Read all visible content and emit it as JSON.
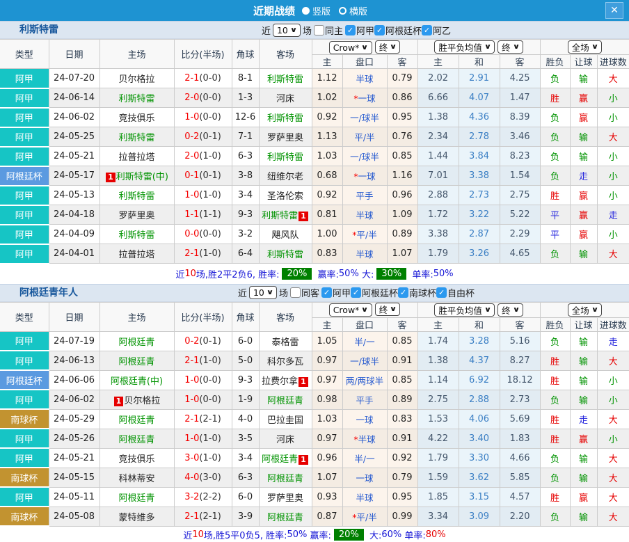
{
  "titlebar": {
    "title": "近期战绩",
    "portrait_label": "竖版",
    "landscape_label": "横版",
    "close_label": "✕"
  },
  "labels": {
    "near": "近",
    "games": "场"
  },
  "dropdowns": {
    "count": "10",
    "company": "Crow*",
    "final": "终",
    "avg": "胜平负均值",
    "scope": "全场"
  },
  "columns": {
    "type": "类型",
    "date": "日期",
    "home": "主场",
    "score": "比分(半场)",
    "corner": "角球",
    "away": "客场",
    "sub": [
      "主",
      "盘口",
      "客",
      "主",
      "和",
      "客",
      "胜负",
      "让球",
      "进球数"
    ]
  },
  "colors": {
    "titlebar": "#1e93d2",
    "league_jia": "#16c5c5",
    "league_acup": "#5b9ae0",
    "league_scup": "#c29330",
    "win_red": "#e60000",
    "lose_green": "#009300",
    "draw_blue": "#2525dd",
    "summary_green_box": "#008000"
  },
  "sections": [
    {
      "team": "利斯特雷",
      "same": {
        "label": "同主",
        "checked": false
      },
      "leagues": [
        {
          "label": "阿甲",
          "checked": true
        },
        {
          "label": "阿根廷杯",
          "checked": true
        },
        {
          "label": "阿乙",
          "checked": true
        }
      ],
      "rows": [
        {
          "type": "阿甲",
          "tc": "jia",
          "date": "24-07-20",
          "home": {
            "n": "贝尔格拉",
            "g": false
          },
          "ft": "2-1",
          "ht": "(0-0)",
          "cn": "8-1",
          "away": {
            "n": "利斯特雷",
            "g": true
          },
          "h": "1.12",
          "star": false,
          "hc": "半球",
          "a": "0.79",
          "m1": "2.02",
          "m2": "2.91",
          "m3": "4.25",
          "r": [
            [
              "负",
              "g"
            ],
            [
              "输",
              "g"
            ],
            [
              "大",
              "r"
            ]
          ]
        },
        {
          "type": "阿甲",
          "tc": "jia",
          "date": "24-06-14",
          "home": {
            "n": "利斯特雷",
            "g": true
          },
          "ft": "2-0",
          "ht": "(0-0)",
          "cn": "1-3",
          "away": {
            "n": "河床",
            "g": false
          },
          "h": "1.02",
          "star": true,
          "hc": "一球",
          "a": "0.86",
          "m1": "6.66",
          "m2": "4.07",
          "m3": "1.47",
          "r": [
            [
              "胜",
              "r"
            ],
            [
              "赢",
              "r"
            ],
            [
              "小",
              "g"
            ]
          ]
        },
        {
          "type": "阿甲",
          "tc": "jia",
          "date": "24-06-02",
          "home": {
            "n": "竞技俱乐",
            "g": false
          },
          "ft": "1-0",
          "ht": "(0-0)",
          "cn": "12-6",
          "away": {
            "n": "利斯特雷",
            "g": true
          },
          "h": "0.92",
          "star": false,
          "hc": "一/球半",
          "a": "0.95",
          "m1": "1.38",
          "m2": "4.36",
          "m3": "8.39",
          "r": [
            [
              "负",
              "g"
            ],
            [
              "赢",
              "r"
            ],
            [
              "小",
              "g"
            ]
          ]
        },
        {
          "type": "阿甲",
          "tc": "jia",
          "date": "24-05-25",
          "home": {
            "n": "利斯特雷",
            "g": true
          },
          "ft": "0-2",
          "ht": "(0-1)",
          "cn": "7-1",
          "away": {
            "n": "罗萨里奥",
            "g": false
          },
          "h": "1.13",
          "star": false,
          "hc": "平/半",
          "a": "0.76",
          "m1": "2.34",
          "m2": "2.78",
          "m3": "3.46",
          "r": [
            [
              "负",
              "g"
            ],
            [
              "输",
              "g"
            ],
            [
              "大",
              "r"
            ]
          ]
        },
        {
          "type": "阿甲",
          "tc": "jia",
          "date": "24-05-21",
          "home": {
            "n": "拉普拉塔",
            "g": false
          },
          "ft": "2-0",
          "ht": "(1-0)",
          "cn": "6-3",
          "away": {
            "n": "利斯特雷",
            "g": true
          },
          "h": "1.03",
          "star": false,
          "hc": "一/球半",
          "a": "0.85",
          "m1": "1.44",
          "m2": "3.84",
          "m3": "8.23",
          "r": [
            [
              "负",
              "g"
            ],
            [
              "输",
              "g"
            ],
            [
              "小",
              "g"
            ]
          ]
        },
        {
          "type": "阿根廷杯",
          "tc": "acup",
          "date": "24-05-17",
          "home": {
            "n": "利斯特雷(中)",
            "g": true,
            "b": "pre"
          },
          "ft": "0-1",
          "ht": "(0-1)",
          "cn": "3-8",
          "away": {
            "n": "纽维尔老",
            "g": false
          },
          "h": "0.68",
          "star": true,
          "hc": "一球",
          "a": "1.16",
          "m1": "7.01",
          "m2": "3.38",
          "m3": "1.54",
          "r": [
            [
              "负",
              "g"
            ],
            [
              "走",
              "b"
            ],
            [
              "小",
              "g"
            ]
          ]
        },
        {
          "type": "阿甲",
          "tc": "jia",
          "date": "24-05-13",
          "home": {
            "n": "利斯特雷",
            "g": true
          },
          "ft": "1-0",
          "ht": "(1-0)",
          "cn": "3-4",
          "away": {
            "n": "圣洛伦索",
            "g": false
          },
          "h": "0.92",
          "star": false,
          "hc": "平手",
          "a": "0.96",
          "m1": "2.88",
          "m2": "2.73",
          "m3": "2.75",
          "r": [
            [
              "胜",
              "r"
            ],
            [
              "赢",
              "r"
            ],
            [
              "小",
              "g"
            ]
          ]
        },
        {
          "type": "阿甲",
          "tc": "jia",
          "date": "24-04-18",
          "home": {
            "n": "罗萨里奥",
            "g": false
          },
          "ft": "1-1",
          "ht": "(1-1)",
          "cn": "9-3",
          "away": {
            "n": "利斯特雷",
            "g": true,
            "b": "post"
          },
          "h": "0.81",
          "star": false,
          "hc": "半球",
          "a": "1.09",
          "m1": "1.72",
          "m2": "3.22",
          "m3": "5.22",
          "r": [
            [
              "平",
              "b"
            ],
            [
              "赢",
              "r"
            ],
            [
              "走",
              "b"
            ]
          ]
        },
        {
          "type": "阿甲",
          "tc": "jia",
          "date": "24-04-09",
          "home": {
            "n": "利斯特雷",
            "g": true
          },
          "ft": "0-0",
          "ht": "(0-0)",
          "cn": "3-2",
          "away": {
            "n": "飓风队",
            "g": false
          },
          "h": "1.00",
          "star": true,
          "hc": "平/半",
          "a": "0.89",
          "m1": "3.38",
          "m2": "2.87",
          "m3": "2.29",
          "r": [
            [
              "平",
              "b"
            ],
            [
              "赢",
              "r"
            ],
            [
              "小",
              "g"
            ]
          ]
        },
        {
          "type": "阿甲",
          "tc": "jia",
          "date": "24-04-01",
          "home": {
            "n": "拉普拉塔",
            "g": false
          },
          "ft": "2-1",
          "ht": "(1-0)",
          "cn": "6-4",
          "away": {
            "n": "利斯特雷",
            "g": true
          },
          "h": "0.83",
          "star": false,
          "hc": "半球",
          "a": "1.07",
          "m1": "1.79",
          "m2": "3.26",
          "m3": "4.65",
          "r": [
            [
              "负",
              "g"
            ],
            [
              "输",
              "g"
            ],
            [
              "大",
              "r"
            ]
          ]
        }
      ],
      "summary": [
        {
          "t": "近",
          "c": "b"
        },
        {
          "t": "10",
          "c": "r"
        },
        {
          "t": "场,胜2平2负6, 胜率:",
          "c": "b"
        },
        {
          "t": "20%",
          "c": "gb"
        },
        {
          "t": " 赢率:",
          "c": "b"
        },
        {
          "t": "50%",
          "c": "b"
        },
        {
          "t": " 大:",
          "c": "b"
        },
        {
          "t": "30%",
          "c": "gb"
        },
        {
          "t": " 单率:",
          "c": "b"
        },
        {
          "t": "50%",
          "c": "b"
        }
      ]
    },
    {
      "team": "阿根廷青年人",
      "same": {
        "label": "同客",
        "checked": false
      },
      "leagues": [
        {
          "label": "阿甲",
          "checked": true
        },
        {
          "label": "阿根廷杯",
          "checked": true
        },
        {
          "label": "南球杯",
          "checked": true
        },
        {
          "label": "自由杯",
          "checked": true
        }
      ],
      "rows": [
        {
          "type": "阿甲",
          "tc": "jia",
          "date": "24-07-19",
          "home": {
            "n": "阿根廷青",
            "g": true
          },
          "ft": "0-2",
          "ht": "(0-1)",
          "cn": "6-0",
          "away": {
            "n": "泰格雷",
            "g": false
          },
          "h": "1.05",
          "star": false,
          "hc": "半/一",
          "a": "0.85",
          "m1": "1.74",
          "m2": "3.28",
          "m3": "5.16",
          "r": [
            [
              "负",
              "g"
            ],
            [
              "输",
              "g"
            ],
            [
              "走",
              "b"
            ]
          ]
        },
        {
          "type": "阿甲",
          "tc": "jia",
          "date": "24-06-13",
          "home": {
            "n": "阿根廷青",
            "g": true
          },
          "ft": "2-1",
          "ht": "(1-0)",
          "cn": "5-0",
          "away": {
            "n": "科尔多瓦",
            "g": false
          },
          "h": "0.97",
          "star": false,
          "hc": "一/球半",
          "a": "0.91",
          "m1": "1.38",
          "m2": "4.37",
          "m3": "8.27",
          "r": [
            [
              "胜",
              "r"
            ],
            [
              "输",
              "g"
            ],
            [
              "大",
              "r"
            ]
          ]
        },
        {
          "type": "阿根廷杯",
          "tc": "acup",
          "date": "24-06-06",
          "home": {
            "n": "阿根廷青(中)",
            "g": true
          },
          "ft": "1-0",
          "ht": "(0-0)",
          "cn": "9-3",
          "away": {
            "n": "拉费尔拿",
            "g": false,
            "b": "post"
          },
          "h": "0.97",
          "star": false,
          "hc": "两/两球半",
          "a": "0.85",
          "m1": "1.14",
          "m2": "6.92",
          "m3": "18.12",
          "r": [
            [
              "胜",
              "r"
            ],
            [
              "输",
              "g"
            ],
            [
              "小",
              "g"
            ]
          ]
        },
        {
          "type": "阿甲",
          "tc": "jia",
          "date": "24-06-02",
          "home": {
            "n": "贝尔格拉",
            "g": false,
            "b": "pre"
          },
          "ft": "1-0",
          "ht": "(0-0)",
          "cn": "1-9",
          "away": {
            "n": "阿根廷青",
            "g": true
          },
          "h": "0.98",
          "star": false,
          "hc": "平手",
          "a": "0.89",
          "m1": "2.75",
          "m2": "2.88",
          "m3": "2.73",
          "r": [
            [
              "负",
              "g"
            ],
            [
              "输",
              "g"
            ],
            [
              "小",
              "g"
            ]
          ]
        },
        {
          "type": "南球杯",
          "tc": "scup",
          "date": "24-05-29",
          "home": {
            "n": "阿根廷青",
            "g": true
          },
          "ft": "2-1",
          "ht": "(2-1)",
          "cn": "4-0",
          "away": {
            "n": "巴拉圭国",
            "g": false
          },
          "h": "1.03",
          "star": false,
          "hc": "一球",
          "a": "0.83",
          "m1": "1.53",
          "m2": "4.06",
          "m3": "5.69",
          "r": [
            [
              "胜",
              "r"
            ],
            [
              "走",
              "b"
            ],
            [
              "大",
              "r"
            ]
          ]
        },
        {
          "type": "阿甲",
          "tc": "jia",
          "date": "24-05-26",
          "home": {
            "n": "阿根廷青",
            "g": true
          },
          "ft": "1-0",
          "ht": "(1-0)",
          "cn": "3-5",
          "away": {
            "n": "河床",
            "g": false
          },
          "h": "0.97",
          "star": true,
          "hc": "半球",
          "a": "0.91",
          "m1": "4.22",
          "m2": "3.40",
          "m3": "1.83",
          "r": [
            [
              "胜",
              "r"
            ],
            [
              "赢",
              "r"
            ],
            [
              "小",
              "g"
            ]
          ]
        },
        {
          "type": "阿甲",
          "tc": "jia",
          "date": "24-05-21",
          "home": {
            "n": "竞技俱乐",
            "g": false
          },
          "ft": "3-0",
          "ht": "(1-0)",
          "cn": "3-4",
          "away": {
            "n": "阿根廷青",
            "g": true,
            "b": "post"
          },
          "h": "0.96",
          "star": false,
          "hc": "半/一",
          "a": "0.92",
          "m1": "1.79",
          "m2": "3.30",
          "m3": "4.66",
          "r": [
            [
              "负",
              "g"
            ],
            [
              "输",
              "g"
            ],
            [
              "大",
              "r"
            ]
          ]
        },
        {
          "type": "南球杯",
          "tc": "scup",
          "date": "24-05-15",
          "home": {
            "n": "科林蒂安",
            "g": false
          },
          "ft": "4-0",
          "ht": "(3-0)",
          "cn": "6-3",
          "away": {
            "n": "阿根廷青",
            "g": true
          },
          "h": "1.07",
          "star": false,
          "hc": "一球",
          "a": "0.79",
          "m1": "1.59",
          "m2": "3.62",
          "m3": "5.85",
          "r": [
            [
              "负",
              "g"
            ],
            [
              "输",
              "g"
            ],
            [
              "大",
              "r"
            ]
          ]
        },
        {
          "type": "阿甲",
          "tc": "jia",
          "date": "24-05-11",
          "home": {
            "n": "阿根廷青",
            "g": true
          },
          "ft": "3-2",
          "ht": "(2-2)",
          "cn": "6-0",
          "away": {
            "n": "罗萨里奥",
            "g": false
          },
          "h": "0.93",
          "star": false,
          "hc": "半球",
          "a": "0.95",
          "m1": "1.85",
          "m2": "3.15",
          "m3": "4.57",
          "r": [
            [
              "胜",
              "r"
            ],
            [
              "赢",
              "r"
            ],
            [
              "大",
              "r"
            ]
          ]
        },
        {
          "type": "南球杯",
          "tc": "scup",
          "date": "24-05-08",
          "home": {
            "n": "蒙特维多",
            "g": false
          },
          "ft": "2-1",
          "ht": "(2-1)",
          "cn": "3-9",
          "away": {
            "n": "阿根廷青",
            "g": true
          },
          "h": "0.87",
          "star": true,
          "hc": "平/半",
          "a": "0.99",
          "m1": "3.34",
          "m2": "3.09",
          "m3": "2.20",
          "r": [
            [
              "负",
              "g"
            ],
            [
              "输",
              "g"
            ],
            [
              "大",
              "r"
            ]
          ]
        }
      ],
      "summary": [
        {
          "t": "近",
          "c": "b"
        },
        {
          "t": "10",
          "c": "r"
        },
        {
          "t": "场,胜5平0负5, 胜率:",
          "c": "b"
        },
        {
          "t": "50%",
          "c": "b"
        },
        {
          "t": " 赢率:",
          "c": "b"
        },
        {
          "t": "20%",
          "c": "gb"
        },
        {
          "t": " 大:",
          "c": "b"
        },
        {
          "t": "60%",
          "c": "b"
        },
        {
          "t": " 单率:",
          "c": "b"
        },
        {
          "t": "80%",
          "c": "r"
        }
      ]
    }
  ]
}
